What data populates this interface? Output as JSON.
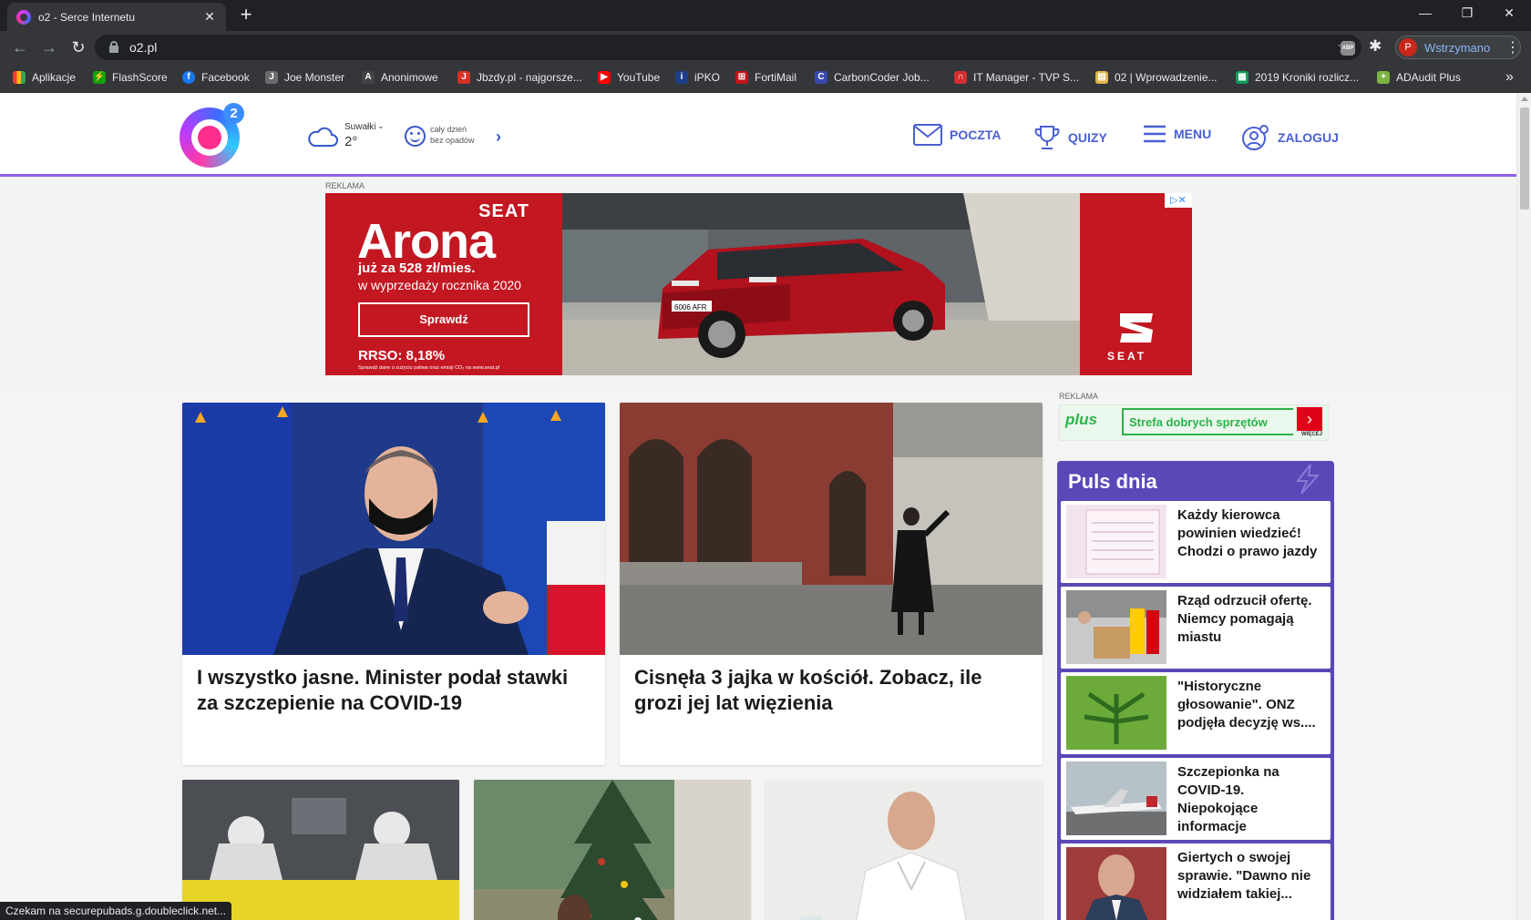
{
  "browser": {
    "tab_title": "o2 - Serce Internetu",
    "url": "o2.pl",
    "profile_initial": "P",
    "profile_status": "Wstrzymano",
    "abp_label": "ABP",
    "bookmarks": [
      {
        "label": "Aplikacje",
        "icon": "apps-grid-icon",
        "color": "#4285f4"
      },
      {
        "label": "FlashScore",
        "icon": "flashscore-icon",
        "color": "#13a10e"
      },
      {
        "label": "Facebook",
        "icon": "facebook-icon",
        "color": "#1877f2"
      },
      {
        "label": "Joe Monster",
        "icon": "joe-monster-icon",
        "color": "#6b6b6b"
      },
      {
        "label": "Anonimowe",
        "icon": "anonimowe-icon",
        "color": "#555555"
      },
      {
        "label": "Jbzdy.pl - najgorsze...",
        "icon": "jbzdy-icon",
        "color": "#d93025"
      },
      {
        "label": "YouTube",
        "icon": "youtube-icon",
        "color": "#ff0000"
      },
      {
        "label": "iPKO",
        "icon": "ipko-icon",
        "color": "#1d3f8a"
      },
      {
        "label": "FortiMail",
        "icon": "fortimail-icon",
        "color": "#c4141b"
      },
      {
        "label": "CarbonCoder Job...",
        "icon": "carboncoder-icon",
        "color": "#3949ab"
      },
      {
        "label": "IT Manager - TVP S...",
        "icon": "tvp-icon",
        "color": "#d32f2f"
      },
      {
        "label": "02 | Wprowadzenie...",
        "icon": "folder-icon",
        "color": "#e0b64a"
      },
      {
        "label": "2019 Kroniki rozlicz...",
        "icon": "sheets-icon",
        "color": "#0f9d58"
      },
      {
        "label": "ADAudit Plus",
        "icon": "adaudit-icon",
        "color": "#7cb342"
      }
    ]
  },
  "header": {
    "logo_sup": "2",
    "weather": {
      "city": "Suwałki",
      "temp": "2°",
      "line1": "cały dzień",
      "line2": "bez opadów"
    },
    "nav": [
      {
        "label": "POCZTA",
        "icon": "mail-icon"
      },
      {
        "label": "QUIZY",
        "icon": "trophy-icon"
      },
      {
        "label": "MENU",
        "icon": "hamburger-icon"
      },
      {
        "label": "ZALOGUJ",
        "icon": "user-icon"
      }
    ]
  },
  "ad_top": {
    "label": "REKLAMA",
    "brand": "SEAT",
    "model": "Arona",
    "price": "już za 528 zł/mies.",
    "sub": "w wyprzedaży rocznika 2020",
    "cta": "Sprawdź",
    "rrso": "RRSO: 8,18%",
    "fine": "Sprawdź dane o zużyciu paliwa oraz emisji CO₂ na www.seat.pl",
    "plate": "6006 AFR",
    "brand_word": "SEAT",
    "close": "▷✕"
  },
  "side_ad": {
    "label": "REKLAMA",
    "logo": "plus",
    "tagline": "Strefa dobrych sprzętów",
    "more": "WIĘCEJ"
  },
  "articles": [
    {
      "title": "I wszystko jasne. Minister podał stawki za szczepienie na COVID-19"
    },
    {
      "title": "Cisnęła 3 jajka w kościół. Zobacz, ile grozi jej lat więzienia"
    }
  ],
  "puls": {
    "title": "Puls dnia",
    "items": [
      {
        "title": "Każdy kierowca powinien wiedzieć! Chodzi o prawo jazdy"
      },
      {
        "title": "Rząd odrzucił ofertę. Niemcy pomagają miastu"
      },
      {
        "title": "\"Historyczne głosowanie\". ONZ podjęła decyzję ws...."
      },
      {
        "title": "Szczepionka na COVID-19. Niepokojące informacje"
      },
      {
        "title": "Giertych o swojej sprawie. \"Dawno nie widziałem takiej..."
      }
    ]
  },
  "status_bar": "Czekam na securepubads.g.doubleclick.net..."
}
